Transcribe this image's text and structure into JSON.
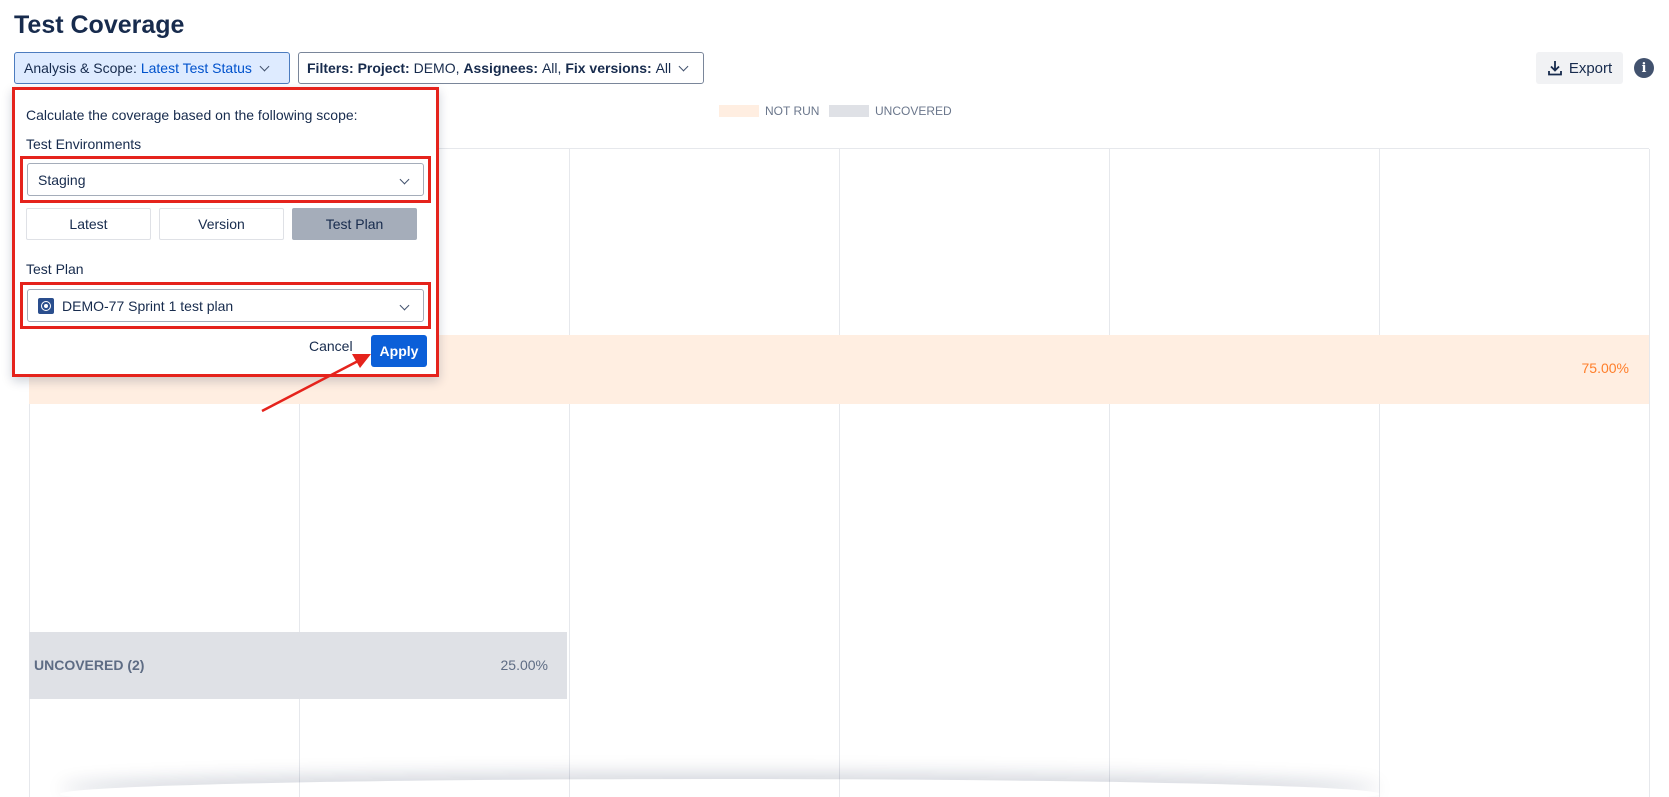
{
  "page": {
    "title": "Test Coverage"
  },
  "toolbar": {
    "scope_label": "Analysis & Scope:",
    "scope_value": "Latest Test Status",
    "filters_label": "Filters:",
    "project_label": "Project:",
    "project_value": "DEMO,",
    "assignees_label": "Assignees:",
    "assignees_value": "All,",
    "fix_versions_label": "Fix versions:",
    "fix_versions_value": "All",
    "export_label": "Export",
    "info_glyph": "i"
  },
  "legend": [
    {
      "label": "NOT RUN",
      "color": "#ffeee1"
    },
    {
      "label": "UNCOVERED",
      "color": "#dfe1e6"
    }
  ],
  "chart": {
    "not_run_pct": "75.00%",
    "uncovered_label": "UNCOVERED (2)",
    "uncovered_pct": "25.00%"
  },
  "scope_popup": {
    "description": "Calculate the coverage based on the following scope:",
    "environments_label": "Test Environments",
    "environment_value": "Staging",
    "modes": [
      "Latest",
      "Version",
      "Test Plan"
    ],
    "active_mode": "Test Plan",
    "test_plan_label": "Test Plan",
    "test_plan_value": "DEMO-77 Sprint 1 test plan",
    "cancel_label": "Cancel",
    "apply_label": "Apply"
  },
  "colors": {
    "accent": "#0b5fd8",
    "highlight": "#e5231c",
    "not_run": "#ff7e2a"
  }
}
